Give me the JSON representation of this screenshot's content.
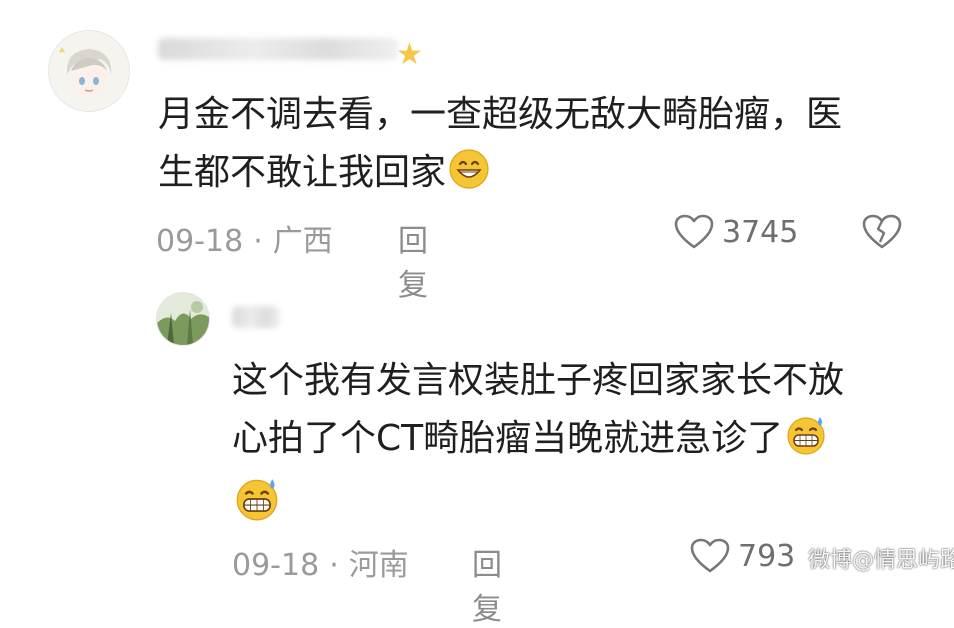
{
  "comments": [
    {
      "text_line1": "月金不调去看，一查超级无敌大畸胎瘤，医",
      "text_line2": "生都不敢让我回家",
      "date": "09-18",
      "separator": "·",
      "location": "广西",
      "reply_label": "回复",
      "likes": "3745",
      "badge_icon": "star-icon",
      "emoji_icon": "grinning-face-icon"
    },
    {
      "text_line1": "这个我有发言权装肚子疼回家家长不放",
      "text_line2": "心拍了个CT畸胎瘤当晚就进急诊了",
      "date": "09-18",
      "separator": "·",
      "location": "河南",
      "reply_label": "回复",
      "likes": "793",
      "emoji_icon": "grinning-sweat-face-icon"
    }
  ],
  "watermark": "微博@情思屿路",
  "colors": {
    "text": "#1f1f1f",
    "meta": "#9a9a9a",
    "emoji_yellow": "#f6c533",
    "sweat_blue": "#5aa8e6"
  }
}
